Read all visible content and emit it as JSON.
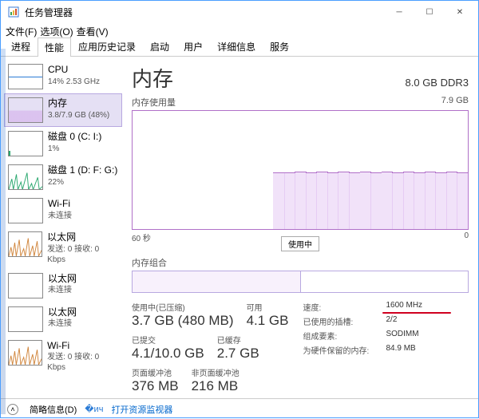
{
  "window": {
    "title": "任务管理器"
  },
  "menu": {
    "file": "文件(F)",
    "options": "选项(O)",
    "view": "查看(V)"
  },
  "tabs": [
    "进程",
    "性能",
    "应用历史记录",
    "启动",
    "用户",
    "详细信息",
    "服务"
  ],
  "active_tab_index": 1,
  "sidebar": [
    {
      "name": "CPU",
      "sub": "14% 2.53 GHz",
      "kind": "cpu"
    },
    {
      "name": "内存",
      "sub": "3.8/7.9 GB (48%)",
      "kind": "mem",
      "selected": true
    },
    {
      "name": "磁盘 0 (C: I:)",
      "sub": "1%",
      "kind": "disk"
    },
    {
      "name": "磁盘 1 (D: F: G:)",
      "sub": "22%",
      "kind": "disk2"
    },
    {
      "name": "Wi-Fi",
      "sub": "未连接",
      "kind": "wifi"
    },
    {
      "name": "以太网",
      "sub": "发送: 0 接收: 0 Kbps",
      "kind": "eth"
    },
    {
      "name": "以太网",
      "sub": "未连接",
      "kind": "eth2"
    },
    {
      "name": "以太网",
      "sub": "未连接",
      "kind": "eth3"
    },
    {
      "name": "Wi-Fi",
      "sub": "发送: 0 接收: 0 Kbps",
      "kind": "wifi2"
    }
  ],
  "main": {
    "title": "内存",
    "subtitle": "8.0 GB DDR3",
    "chart_label": "内存使用量",
    "chart_max_label": "7.9 GB",
    "x_left": "60 秒",
    "x_right": "0",
    "mid_label": "使用中",
    "slots_label": "内存组合"
  },
  "stats_left": [
    [
      {
        "lab": "使用中(已压缩)",
        "val": "3.7 GB (480 MB)"
      },
      {
        "lab": "可用",
        "val": "4.1 GB"
      }
    ],
    [
      {
        "lab": "已提交",
        "val": "4.1/10.0 GB"
      },
      {
        "lab": "已缓存",
        "val": "2.7 GB"
      }
    ],
    [
      {
        "lab": "页面缓冲池",
        "val": "376 MB"
      },
      {
        "lab": "非页面缓冲池",
        "val": "216 MB"
      }
    ]
  ],
  "stats_right": [
    {
      "lab": "速度:",
      "val": "1600 MHz",
      "hl": true
    },
    {
      "lab": "已使用的插槽:",
      "val": "2/2"
    },
    {
      "lab": "组成要素:",
      "val": "SODIMM"
    },
    {
      "lab": "为硬件保留的内存:",
      "val": "84.9 MB"
    }
  ],
  "bottom": {
    "less": "简略信息(D)",
    "link": "打开资源监视器"
  },
  "chart_data": {
    "type": "area",
    "title": "内存使用量",
    "xlabel": "60 秒 → 0",
    "ylabel": "GB",
    "ylim": [
      0,
      7.9
    ],
    "x_seconds": [
      60,
      58,
      56,
      54,
      52,
      50,
      48,
      46,
      44,
      42,
      40,
      38,
      36,
      34,
      32,
      30,
      28,
      26,
      24,
      22,
      20,
      18,
      16,
      14,
      12,
      10,
      8,
      6,
      4,
      2,
      0
    ],
    "values_gb": [
      0,
      0,
      0,
      0,
      0,
      0,
      0,
      0,
      0,
      0,
      0,
      0,
      0,
      3.8,
      3.8,
      3.85,
      3.8,
      3.85,
      3.8,
      3.85,
      3.8,
      3.85,
      3.8,
      3.85,
      3.8,
      3.85,
      3.8,
      3.85,
      3.8,
      3.85,
      3.8
    ]
  }
}
